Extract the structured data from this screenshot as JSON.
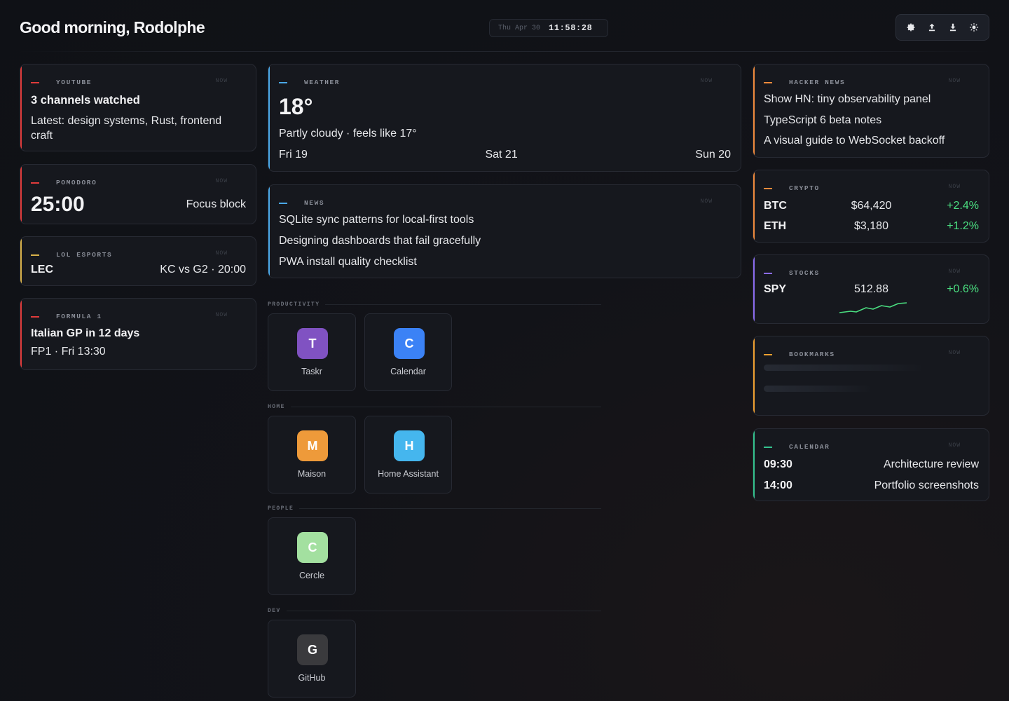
{
  "header": {
    "greeting": "Good morning, Rodolphe",
    "date": "Thu Apr 30",
    "time": "11:58:28",
    "tools": [
      "gear-icon",
      "upload-icon",
      "download-icon",
      "sun-icon"
    ]
  },
  "colors": {
    "red": "#e03b3b",
    "blue": "#4aa8e8",
    "yellow": "#d8b14a",
    "orange": "#f08a3c",
    "purple": "#8b6cf0",
    "green": "#34c38f",
    "up": "#4ade80"
  },
  "youtube": {
    "label": "YOUTUBE",
    "now": "NOW",
    "title": "3 channels watched",
    "subtitle": "Latest: design systems, Rust, frontend craft"
  },
  "pomodoro": {
    "label": "POMODORO",
    "now": "NOW",
    "timer": "25:00",
    "mode": "Focus block"
  },
  "lol": {
    "label": "LOL ESPORTS",
    "now": "NOW",
    "league": "LEC",
    "match": "KC vs G2 · 20:00"
  },
  "f1": {
    "label": "FORMULA 1",
    "now": "NOW",
    "title": "Italian GP in 12 days",
    "session": "FP1 · Fri 13:30"
  },
  "weather": {
    "label": "WEATHER",
    "now": "NOW",
    "temp": "18°",
    "summary": "Partly cloudy · feels like 17°",
    "forecast": [
      "Fri 19",
      "Sat 21",
      "Sun 20"
    ]
  },
  "news": {
    "label": "NEWS",
    "now": "NOW",
    "items": [
      "SQLite sync patterns for local-first tools",
      "Designing dashboards that fail gracefully",
      "PWA install quality checklist"
    ]
  },
  "sections": {
    "productivity": "PRODUCTIVITY",
    "home": "HOME",
    "people": "PEOPLE",
    "dev": "DEV"
  },
  "apps": [
    {
      "letter": "T",
      "name": "Taskr",
      "color": "#8052c2"
    },
    {
      "letter": "C",
      "name": "Calendar",
      "color": "#3b82f6"
    },
    {
      "letter": "M",
      "name": "Maison",
      "color": "#ee9a3a"
    },
    {
      "letter": "H",
      "name": "Home Assistant",
      "color": "#45b6ee"
    },
    {
      "letter": "C",
      "name": "Cercle",
      "color": "#a3e0a0"
    },
    {
      "letter": "G",
      "name": "GitHub",
      "color": "#3a3a3d"
    }
  ],
  "hn": {
    "label": "HACKER NEWS",
    "now": "NOW",
    "items": [
      "Show HN: tiny observability panel",
      "TypeScript 6 beta notes",
      "A visual guide to WebSocket backoff"
    ]
  },
  "crypto": {
    "label": "CRYPTO",
    "now": "NOW",
    "rows": [
      {
        "symbol": "BTC",
        "price": "$64,420",
        "change": "+2.4%"
      },
      {
        "symbol": "ETH",
        "price": "$3,180",
        "change": "+1.2%"
      }
    ]
  },
  "stocks": {
    "label": "STOCKS",
    "now": "NOW",
    "symbol": "SPY",
    "price": "512.88",
    "change": "+0.6%"
  },
  "bookmarks": {
    "label": "BOOKMARKS",
    "now": "NOW"
  },
  "calendar": {
    "label": "CALENDAR",
    "now": "NOW",
    "events": [
      {
        "time": "09:30",
        "title": "Architecture review"
      },
      {
        "time": "14:00",
        "title": "Portfolio screenshots"
      }
    ]
  }
}
